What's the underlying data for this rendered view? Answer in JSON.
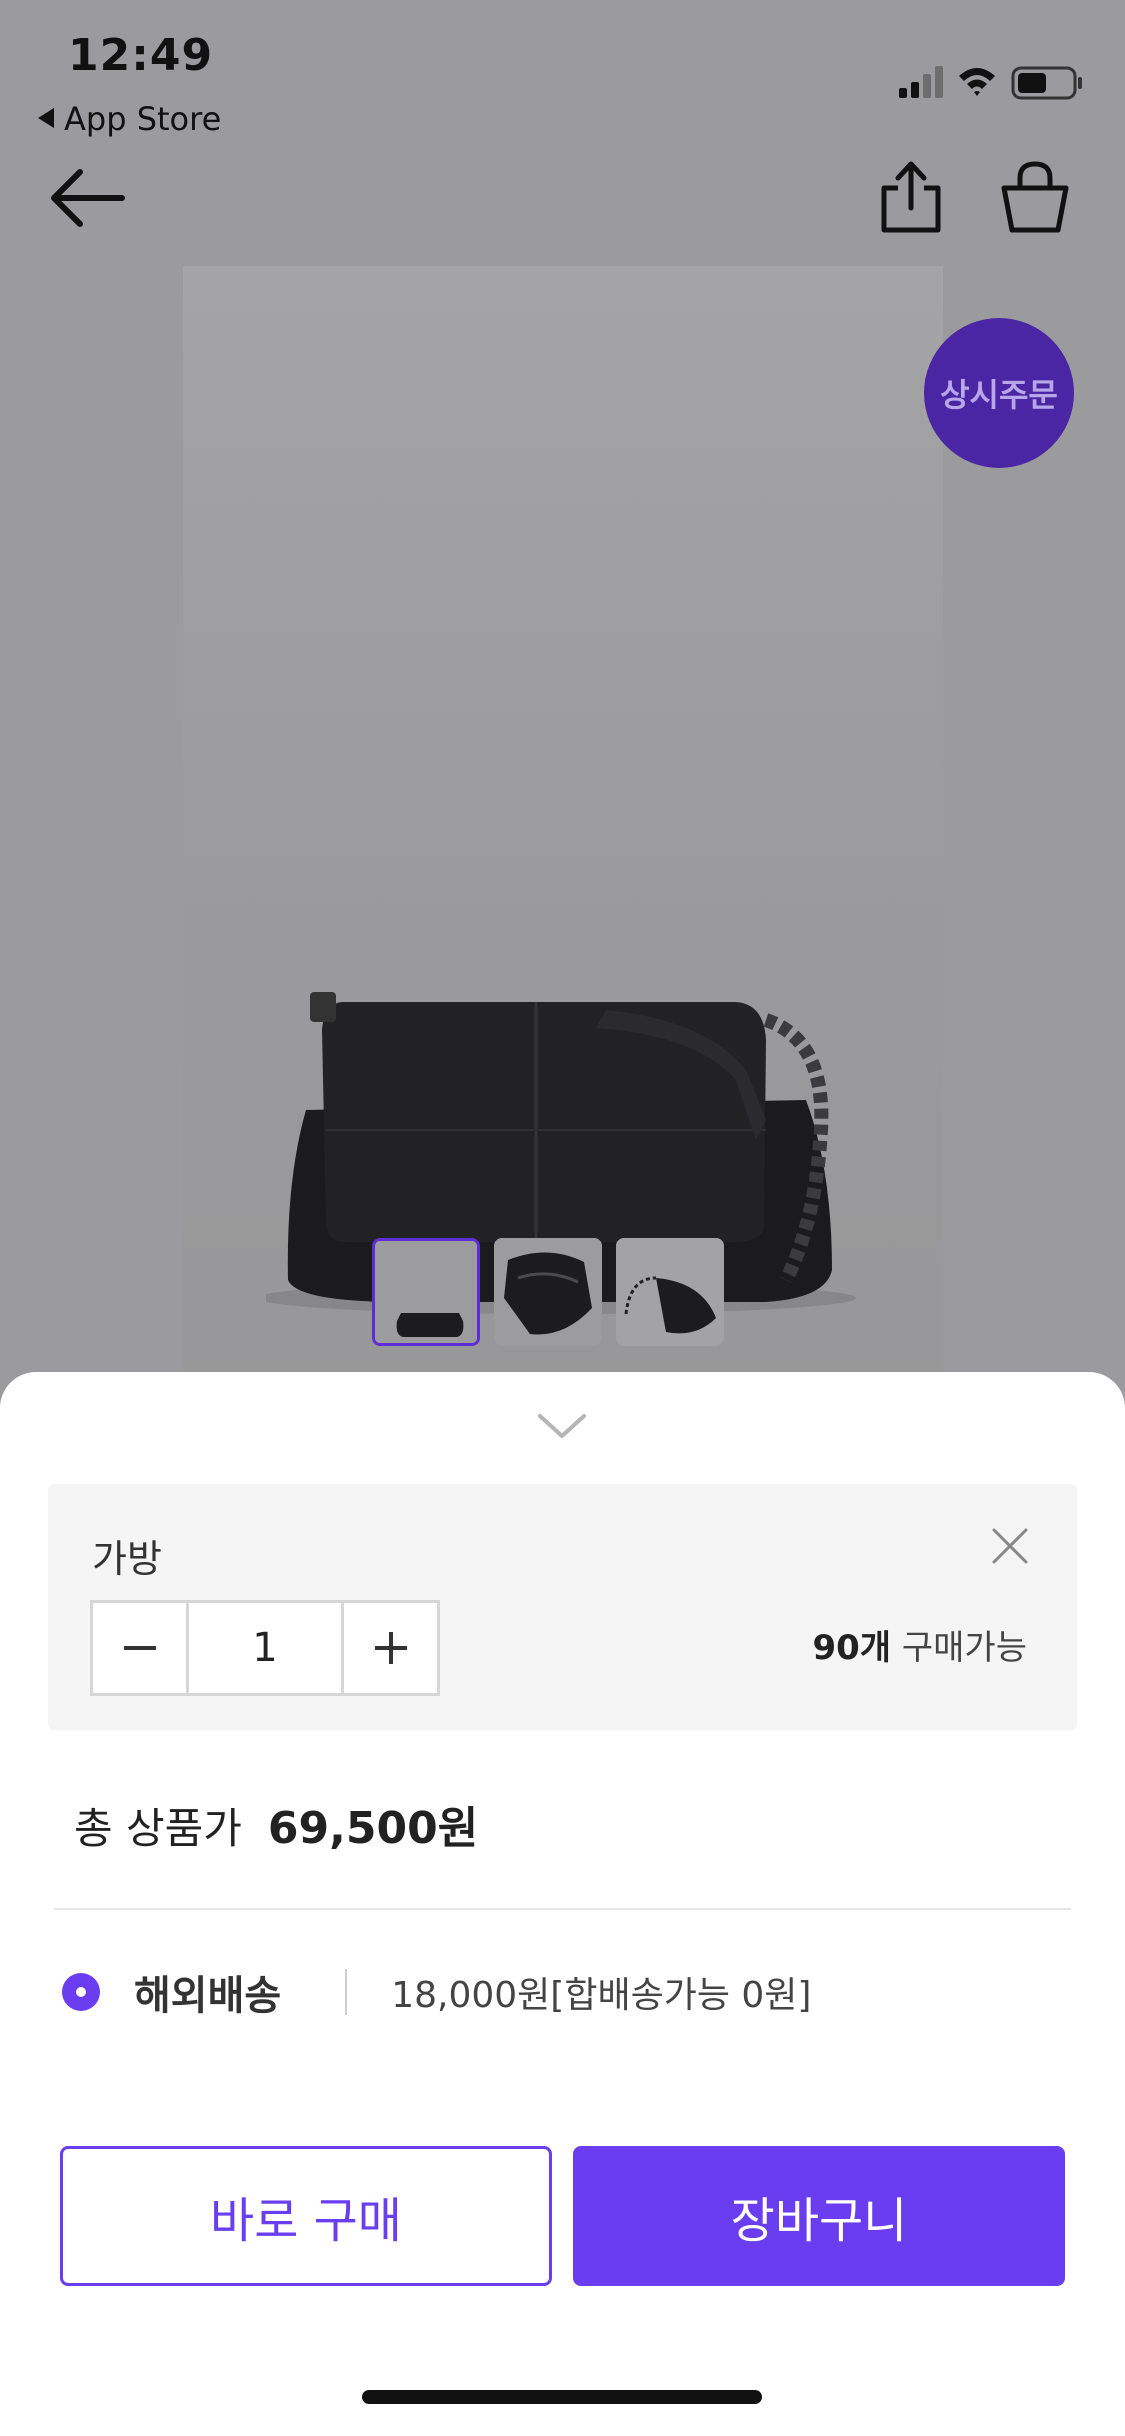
{
  "status_bar": {
    "time": "12:49",
    "back_app": "App Store"
  },
  "product": {
    "badge": "상시주문",
    "thumbnails": [
      "bag-thumb-front",
      "bag-thumb-folded",
      "bag-thumb-side"
    ]
  },
  "option": {
    "name": "가방",
    "quantity": "1",
    "stock_count": "90개",
    "stock_suffix": " 구매가능"
  },
  "total": {
    "label": "총 상품가",
    "value": "69,500원"
  },
  "shipping": {
    "label": "해외배송",
    "fee": "18,000원[합배송가능 0원]"
  },
  "buttons": {
    "buy_now": "바로 구매",
    "cart": "장바구니"
  },
  "colors": {
    "accent": "#6a3df0",
    "badge_bg": "#4a25a4",
    "overlay": "#9b9b9d"
  }
}
